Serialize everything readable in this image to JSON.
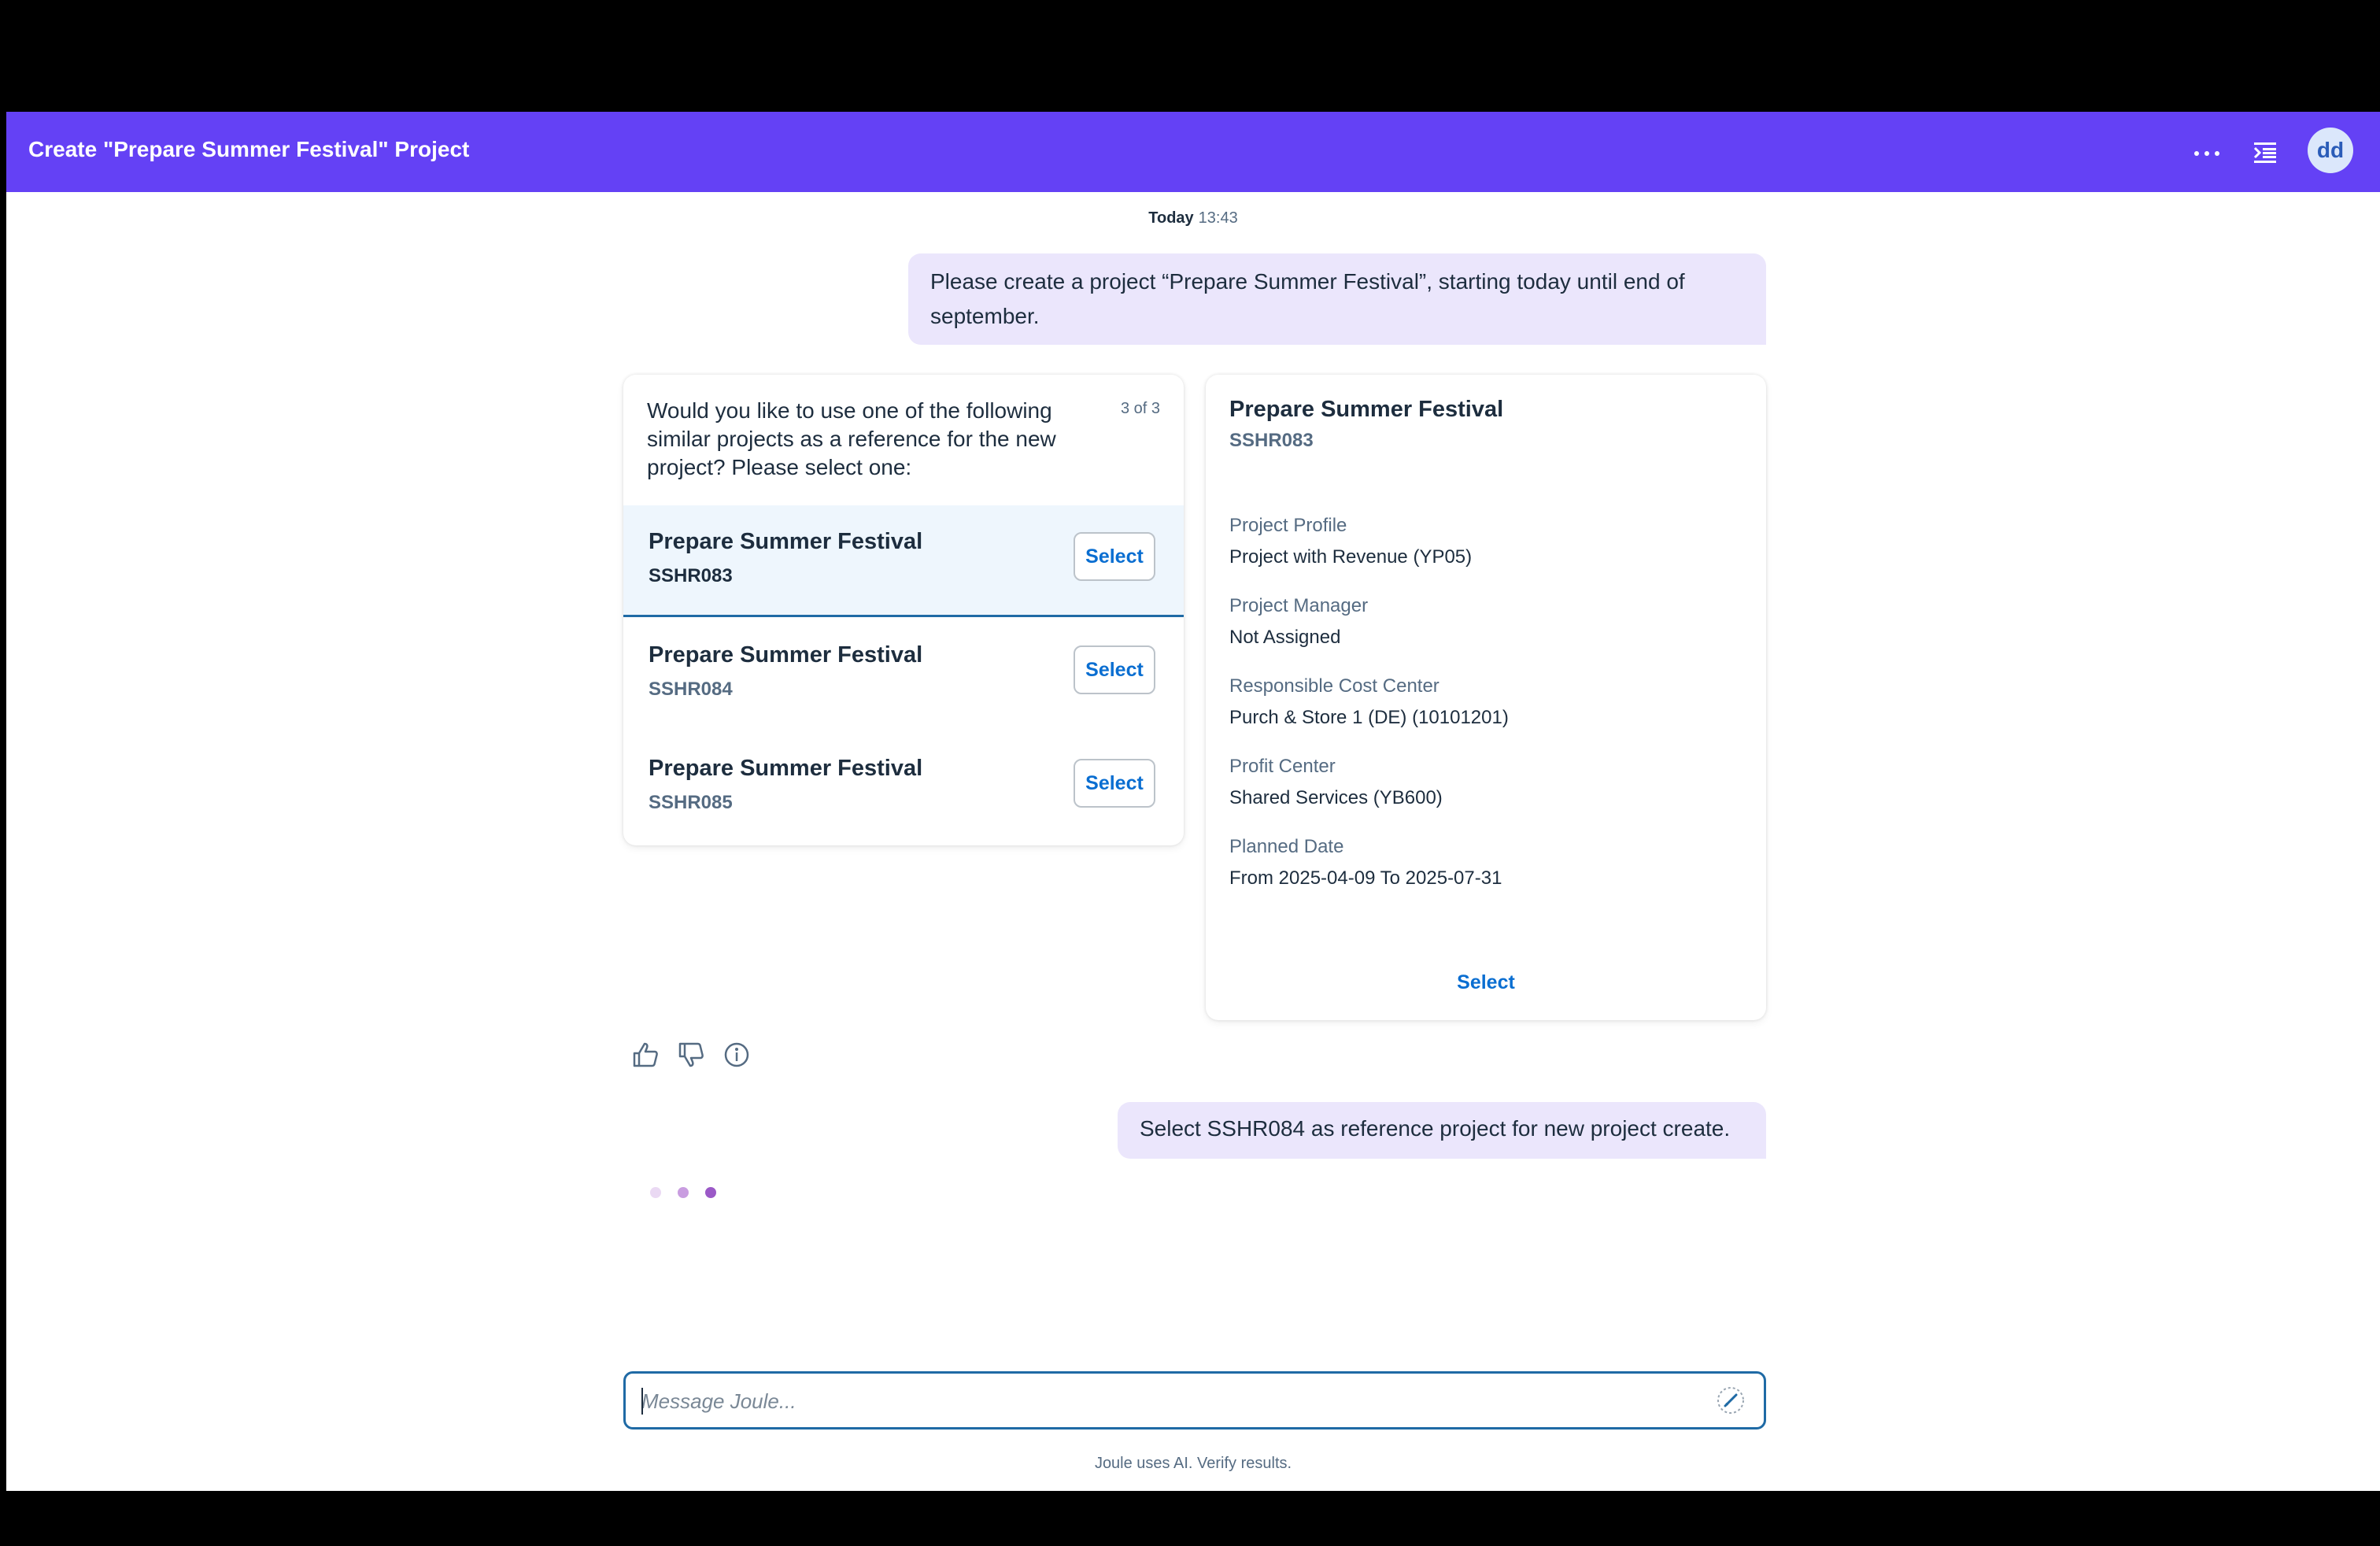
{
  "header": {
    "title": "Create \"Prepare Summer Festival\" Project",
    "more_icon": "more-horizontal-icon",
    "panel_icon": "collapse-panel-icon",
    "avatar_initials": "dd"
  },
  "timestamp": {
    "day": "Today",
    "time": "13:43"
  },
  "messages": {
    "user_request": "Please create a project “Prepare Summer Festival”, starting today until end of september.",
    "user_selection": "Select SSHR084 as reference project for new project create."
  },
  "reference_card": {
    "question": "Would you like to use one of the following similar projects as a reference for the new project? Please select one:",
    "counter": "3 of 3",
    "items": [
      {
        "title": "Prepare Summer Festival",
        "id": "SSHR083",
        "button": "Select"
      },
      {
        "title": "Prepare Summer Festival",
        "id": "SSHR084",
        "button": "Select"
      },
      {
        "title": "Prepare Summer Festival",
        "id": "SSHR085",
        "button": "Select"
      }
    ]
  },
  "detail_card": {
    "title": "Prepare Summer Festival",
    "id": "SSHR083",
    "fields": [
      {
        "label": "Project Profile",
        "value": "Project with Revenue (YP05)"
      },
      {
        "label": "Project Manager",
        "value": "Not Assigned"
      },
      {
        "label": "Responsible Cost Center",
        "value": "Purch & Store 1 (DE) (10101201)"
      },
      {
        "label": "Profit Center",
        "value": "Shared Services (YB600)"
      },
      {
        "label": "Planned Date",
        "value": "From 2025-04-09 To 2025-07-31"
      }
    ],
    "select_label": "Select"
  },
  "feedback_icons": [
    "thumbs-up-icon",
    "thumbs-down-icon",
    "info-icon"
  ],
  "typing_indicator": {
    "dot_colors": [
      "#ead9f3",
      "#c99de0",
      "#9b59c7"
    ]
  },
  "composer": {
    "placeholder": "Message Joule...",
    "value": "",
    "send_icon": "send-icon"
  },
  "disclaimer": "Joule uses AI. Verify results.",
  "colors": {
    "header": "#6441f5",
    "user_bubble": "#ebe6fc",
    "link": "#0a6ed1",
    "focus": "#1f6aa5"
  }
}
